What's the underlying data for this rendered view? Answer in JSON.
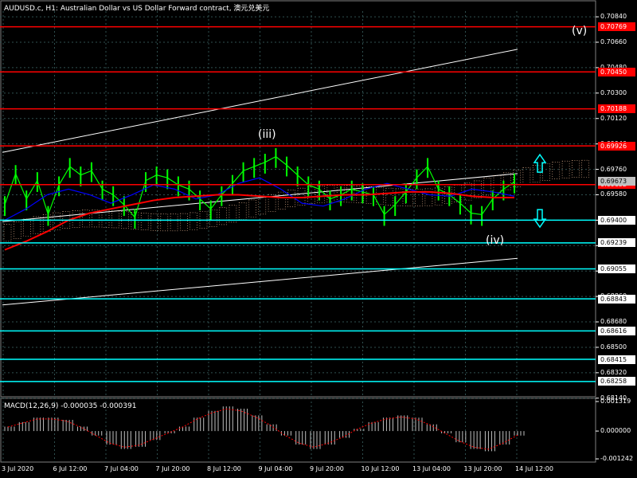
{
  "title": "AUDUSD.c, H1:  Australian Dollar vs US Dollar Forward contract, 澳元兑美元",
  "macd_title": "MACD(12,26,9) -0.000035 -0.000391",
  "colors": {
    "background": "#000000",
    "grid": "#2f4f4f",
    "resistance": "#ff0000",
    "support": "#00ffff",
    "price_line": "#00ff00",
    "ma_red": "#ff0000",
    "ma_blue": "#0000ff",
    "channel": "#ffffff",
    "cloud": "#ffc8a0",
    "arrow": "#00ffff"
  },
  "y_axis_ticks": [
    "0.70840",
    "0.70660",
    "0.70480",
    "0.70300",
    "0.70120",
    "0.69940",
    "0.69760",
    "0.69580",
    "0.69400",
    "0.69220",
    "0.69040",
    "0.68860",
    "0.68680",
    "0.68500",
    "0.68320",
    "0.68140"
  ],
  "macd_ticks": [
    "0.001319",
    "0.000000",
    "-0.001242"
  ],
  "x_axis_ticks": [
    "3 Jul 2020",
    "6 Jul 12:00",
    "7 Jul 04:00",
    "7 Jul 20:00",
    "8 Jul 12:00",
    "9 Jul 04:00",
    "9 Jul 20:00",
    "10 Jul 12:00",
    "13 Jul 04:00",
    "13 Jul 20:00",
    "14 Jul 12:00"
  ],
  "wave_labels": [
    "(iii)",
    "(iv)",
    "(v)"
  ],
  "chart_data": {
    "type": "line",
    "title": "AUDUSD.c, H1:  Australian Dollar vs US Dollar Forward contract, 澳元兑美元",
    "ylim": [
      0.6815,
      0.7088
    ],
    "resistance_levels": [
      {
        "label": "0.70769",
        "value": 0.70769
      },
      {
        "label": "0.70450",
        "value": 0.7045
      },
      {
        "label": "0.70188",
        "value": 0.70188
      },
      {
        "label": "0.69926",
        "value": 0.69926
      },
      {
        "label": "0.69652",
        "value": 0.69652
      }
    ],
    "support_levels": [
      {
        "label": "0.69400",
        "value": 0.694
      },
      {
        "label": "0.69239",
        "value": 0.69239
      },
      {
        "label": "0.69055",
        "value": 0.69055
      },
      {
        "label": "0.68843",
        "value": 0.68843
      },
      {
        "label": "0.68616",
        "value": 0.68616
      },
      {
        "label": "0.68415",
        "value": 0.68415
      },
      {
        "label": "0.68258",
        "value": 0.68258
      }
    ],
    "current_price": {
      "label": "0.69673",
      "value": 0.69673
    },
    "price_series": [
      0.6951,
      0.6973,
      0.6955,
      0.6968,
      0.6944,
      0.6965,
      0.6978,
      0.6972,
      0.6975,
      0.6962,
      0.6958,
      0.6951,
      0.6942,
      0.6968,
      0.6972,
      0.697,
      0.6965,
      0.6962,
      0.6955,
      0.6948,
      0.6958,
      0.6966,
      0.6975,
      0.6978,
      0.6981,
      0.6985,
      0.6979,
      0.6972,
      0.6965,
      0.6962,
      0.6955,
      0.6958,
      0.6962,
      0.696,
      0.6958,
      0.6944,
      0.6951,
      0.696,
      0.697,
      0.6978,
      0.6962,
      0.6958,
      0.6952,
      0.6945,
      0.6944,
      0.6955,
      0.6962,
      0.6967
    ],
    "ma_red": [
      0.6919,
      0.6925,
      0.6932,
      0.694,
      0.6945,
      0.6948,
      0.6951,
      0.6954,
      0.6956,
      0.6957,
      0.6958,
      0.6958,
      0.6957,
      0.6956,
      0.6956,
      0.6957,
      0.6958,
      0.6958,
      0.6959,
      0.696,
      0.696,
      0.6959,
      0.6957,
      0.6956,
      0.6956
    ],
    "ma_blue": [
      0.694,
      0.6948,
      0.6958,
      0.6962,
      0.6958,
      0.6952,
      0.6958,
      0.6965,
      0.6962,
      0.6955,
      0.6958,
      0.6966,
      0.697,
      0.6962,
      0.6952,
      0.695,
      0.6955,
      0.6962,
      0.6966,
      0.6962,
      0.6958,
      0.6957,
      0.6962,
      0.696,
      0.6957
    ],
    "channel_upper": {
      "start": 0.6988,
      "end": 0.7061
    },
    "channel_lower": {
      "start": 0.688,
      "end": 0.6913
    },
    "macd": [
      0.0002,
      0.0004,
      0.0006,
      0.0006,
      0.0005,
      0.0002,
      -0.0002,
      -0.0006,
      -0.0008,
      -0.0007,
      -0.0004,
      -0.0001,
      0.0002,
      0.0006,
      0.0009,
      0.0011,
      0.001,
      0.0007,
      0.0003,
      -0.0002,
      -0.0006,
      -0.0008,
      -0.0006,
      -0.0003,
      0.0001,
      0.0004,
      0.0006,
      0.0007,
      0.0006,
      0.0003,
      -0.0001,
      -0.0005,
      -0.0008,
      -0.0009,
      -0.0006,
      -0.0002
    ],
    "macd_ylim": [
      -0.001242,
      0.001319
    ]
  }
}
